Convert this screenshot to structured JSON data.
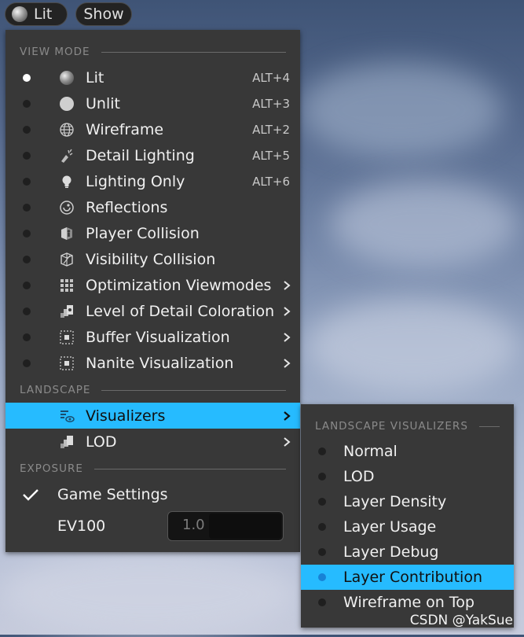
{
  "toolbar": {
    "lit_label": "Lit",
    "show_label": "Show"
  },
  "view_mode_menu": {
    "section_view_mode": "VIEW MODE",
    "items": [
      {
        "label": "Lit",
        "shortcut": "ALT+4",
        "icon": "sphere-lit-icon",
        "selected": true
      },
      {
        "label": "Unlit",
        "shortcut": "ALT+3",
        "icon": "sphere-unlit-icon"
      },
      {
        "label": "Wireframe",
        "shortcut": "ALT+2",
        "icon": "wireframe-globe-icon"
      },
      {
        "label": "Detail Lighting",
        "shortcut": "ALT+5",
        "icon": "detail-lighting-icon"
      },
      {
        "label": "Lighting Only",
        "shortcut": "ALT+6",
        "icon": "lightbulb-icon"
      },
      {
        "label": "Reflections",
        "shortcut": "",
        "icon": "reflections-icon"
      },
      {
        "label": "Player Collision",
        "shortcut": "",
        "icon": "player-collision-icon"
      },
      {
        "label": "Visibility Collision",
        "shortcut": "",
        "icon": "visibility-collision-icon"
      },
      {
        "label": "Optimization Viewmodes",
        "shortcut": "",
        "icon": "grid-icon",
        "submenu": true
      },
      {
        "label": "Level of Detail Coloration",
        "shortcut": "",
        "icon": "lod-coloration-icon",
        "submenu": true
      },
      {
        "label": "Buffer Visualization",
        "shortcut": "",
        "icon": "buffer-icon",
        "submenu": true
      },
      {
        "label": "Nanite Visualization",
        "shortcut": "",
        "icon": "nanite-icon",
        "submenu": true
      }
    ],
    "section_landscape": "LANDSCAPE",
    "landscape_items": [
      {
        "label": "Visualizers",
        "icon": "visualizers-icon",
        "submenu": true,
        "highlighted": true
      },
      {
        "label": "LOD",
        "icon": "lod-icon",
        "submenu": true
      }
    ],
    "section_exposure": "EXPOSURE",
    "game_settings_label": "Game Settings",
    "ev100_label": "EV100",
    "ev100_value": "1.0"
  },
  "landscape_visualizers_menu": {
    "section_title": "LANDSCAPE VISUALIZERS",
    "items": [
      {
        "label": "Normal"
      },
      {
        "label": "LOD"
      },
      {
        "label": "Layer Density"
      },
      {
        "label": "Layer Usage"
      },
      {
        "label": "Layer Debug"
      },
      {
        "label": "Layer Contribution",
        "highlighted": true
      },
      {
        "label": "Wireframe on Top"
      }
    ]
  },
  "watermark": "CSDN @YakSue",
  "colors": {
    "highlight": "#26bbff",
    "menu_bg": "#383838",
    "radio_selected_blue": "#1782d6"
  }
}
